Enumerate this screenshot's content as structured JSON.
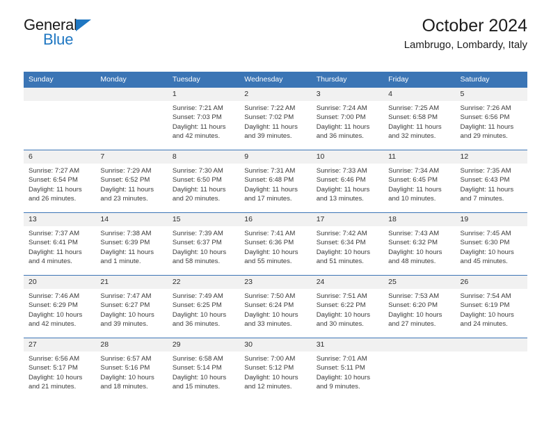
{
  "brand": {
    "name_top": "General",
    "name_bottom": "Blue",
    "accent_color": "#1f77c2"
  },
  "header": {
    "title": "October 2024",
    "subtitle": "Lambrugo, Lombardy, Italy"
  },
  "theme": {
    "header_blue": "#3b75b5",
    "daynum_band": "#f1f1f1",
    "text": "#3a3a3a"
  },
  "weekdays": [
    "Sunday",
    "Monday",
    "Tuesday",
    "Wednesday",
    "Thursday",
    "Friday",
    "Saturday"
  ],
  "weeks": [
    [
      {
        "day": "",
        "sunrise": "",
        "sunset": "",
        "daylight_line1": "",
        "daylight_line2": ""
      },
      {
        "day": "",
        "sunrise": "",
        "sunset": "",
        "daylight_line1": "",
        "daylight_line2": ""
      },
      {
        "day": "1",
        "sunrise": "Sunrise: 7:21 AM",
        "sunset": "Sunset: 7:03 PM",
        "daylight_line1": "Daylight: 11 hours",
        "daylight_line2": "and 42 minutes."
      },
      {
        "day": "2",
        "sunrise": "Sunrise: 7:22 AM",
        "sunset": "Sunset: 7:02 PM",
        "daylight_line1": "Daylight: 11 hours",
        "daylight_line2": "and 39 minutes."
      },
      {
        "day": "3",
        "sunrise": "Sunrise: 7:24 AM",
        "sunset": "Sunset: 7:00 PM",
        "daylight_line1": "Daylight: 11 hours",
        "daylight_line2": "and 36 minutes."
      },
      {
        "day": "4",
        "sunrise": "Sunrise: 7:25 AM",
        "sunset": "Sunset: 6:58 PM",
        "daylight_line1": "Daylight: 11 hours",
        "daylight_line2": "and 32 minutes."
      },
      {
        "day": "5",
        "sunrise": "Sunrise: 7:26 AM",
        "sunset": "Sunset: 6:56 PM",
        "daylight_line1": "Daylight: 11 hours",
        "daylight_line2": "and 29 minutes."
      }
    ],
    [
      {
        "day": "6",
        "sunrise": "Sunrise: 7:27 AM",
        "sunset": "Sunset: 6:54 PM",
        "daylight_line1": "Daylight: 11 hours",
        "daylight_line2": "and 26 minutes."
      },
      {
        "day": "7",
        "sunrise": "Sunrise: 7:29 AM",
        "sunset": "Sunset: 6:52 PM",
        "daylight_line1": "Daylight: 11 hours",
        "daylight_line2": "and 23 minutes."
      },
      {
        "day": "8",
        "sunrise": "Sunrise: 7:30 AM",
        "sunset": "Sunset: 6:50 PM",
        "daylight_line1": "Daylight: 11 hours",
        "daylight_line2": "and 20 minutes."
      },
      {
        "day": "9",
        "sunrise": "Sunrise: 7:31 AM",
        "sunset": "Sunset: 6:48 PM",
        "daylight_line1": "Daylight: 11 hours",
        "daylight_line2": "and 17 minutes."
      },
      {
        "day": "10",
        "sunrise": "Sunrise: 7:33 AM",
        "sunset": "Sunset: 6:46 PM",
        "daylight_line1": "Daylight: 11 hours",
        "daylight_line2": "and 13 minutes."
      },
      {
        "day": "11",
        "sunrise": "Sunrise: 7:34 AM",
        "sunset": "Sunset: 6:45 PM",
        "daylight_line1": "Daylight: 11 hours",
        "daylight_line2": "and 10 minutes."
      },
      {
        "day": "12",
        "sunrise": "Sunrise: 7:35 AM",
        "sunset": "Sunset: 6:43 PM",
        "daylight_line1": "Daylight: 11 hours",
        "daylight_line2": "and 7 minutes."
      }
    ],
    [
      {
        "day": "13",
        "sunrise": "Sunrise: 7:37 AM",
        "sunset": "Sunset: 6:41 PM",
        "daylight_line1": "Daylight: 11 hours",
        "daylight_line2": "and 4 minutes."
      },
      {
        "day": "14",
        "sunrise": "Sunrise: 7:38 AM",
        "sunset": "Sunset: 6:39 PM",
        "daylight_line1": "Daylight: 11 hours",
        "daylight_line2": "and 1 minute."
      },
      {
        "day": "15",
        "sunrise": "Sunrise: 7:39 AM",
        "sunset": "Sunset: 6:37 PM",
        "daylight_line1": "Daylight: 10 hours",
        "daylight_line2": "and 58 minutes."
      },
      {
        "day": "16",
        "sunrise": "Sunrise: 7:41 AM",
        "sunset": "Sunset: 6:36 PM",
        "daylight_line1": "Daylight: 10 hours",
        "daylight_line2": "and 55 minutes."
      },
      {
        "day": "17",
        "sunrise": "Sunrise: 7:42 AM",
        "sunset": "Sunset: 6:34 PM",
        "daylight_line1": "Daylight: 10 hours",
        "daylight_line2": "and 51 minutes."
      },
      {
        "day": "18",
        "sunrise": "Sunrise: 7:43 AM",
        "sunset": "Sunset: 6:32 PM",
        "daylight_line1": "Daylight: 10 hours",
        "daylight_line2": "and 48 minutes."
      },
      {
        "day": "19",
        "sunrise": "Sunrise: 7:45 AM",
        "sunset": "Sunset: 6:30 PM",
        "daylight_line1": "Daylight: 10 hours",
        "daylight_line2": "and 45 minutes."
      }
    ],
    [
      {
        "day": "20",
        "sunrise": "Sunrise: 7:46 AM",
        "sunset": "Sunset: 6:29 PM",
        "daylight_line1": "Daylight: 10 hours",
        "daylight_line2": "and 42 minutes."
      },
      {
        "day": "21",
        "sunrise": "Sunrise: 7:47 AM",
        "sunset": "Sunset: 6:27 PM",
        "daylight_line1": "Daylight: 10 hours",
        "daylight_line2": "and 39 minutes."
      },
      {
        "day": "22",
        "sunrise": "Sunrise: 7:49 AM",
        "sunset": "Sunset: 6:25 PM",
        "daylight_line1": "Daylight: 10 hours",
        "daylight_line2": "and 36 minutes."
      },
      {
        "day": "23",
        "sunrise": "Sunrise: 7:50 AM",
        "sunset": "Sunset: 6:24 PM",
        "daylight_line1": "Daylight: 10 hours",
        "daylight_line2": "and 33 minutes."
      },
      {
        "day": "24",
        "sunrise": "Sunrise: 7:51 AM",
        "sunset": "Sunset: 6:22 PM",
        "daylight_line1": "Daylight: 10 hours",
        "daylight_line2": "and 30 minutes."
      },
      {
        "day": "25",
        "sunrise": "Sunrise: 7:53 AM",
        "sunset": "Sunset: 6:20 PM",
        "daylight_line1": "Daylight: 10 hours",
        "daylight_line2": "and 27 minutes."
      },
      {
        "day": "26",
        "sunrise": "Sunrise: 7:54 AM",
        "sunset": "Sunset: 6:19 PM",
        "daylight_line1": "Daylight: 10 hours",
        "daylight_line2": "and 24 minutes."
      }
    ],
    [
      {
        "day": "27",
        "sunrise": "Sunrise: 6:56 AM",
        "sunset": "Sunset: 5:17 PM",
        "daylight_line1": "Daylight: 10 hours",
        "daylight_line2": "and 21 minutes."
      },
      {
        "day": "28",
        "sunrise": "Sunrise: 6:57 AM",
        "sunset": "Sunset: 5:16 PM",
        "daylight_line1": "Daylight: 10 hours",
        "daylight_line2": "and 18 minutes."
      },
      {
        "day": "29",
        "sunrise": "Sunrise: 6:58 AM",
        "sunset": "Sunset: 5:14 PM",
        "daylight_line1": "Daylight: 10 hours",
        "daylight_line2": "and 15 minutes."
      },
      {
        "day": "30",
        "sunrise": "Sunrise: 7:00 AM",
        "sunset": "Sunset: 5:12 PM",
        "daylight_line1": "Daylight: 10 hours",
        "daylight_line2": "and 12 minutes."
      },
      {
        "day": "31",
        "sunrise": "Sunrise: 7:01 AM",
        "sunset": "Sunset: 5:11 PM",
        "daylight_line1": "Daylight: 10 hours",
        "daylight_line2": "and 9 minutes."
      },
      {
        "day": "",
        "sunrise": "",
        "sunset": "",
        "daylight_line1": "",
        "daylight_line2": ""
      },
      {
        "day": "",
        "sunrise": "",
        "sunset": "",
        "daylight_line1": "",
        "daylight_line2": ""
      }
    ]
  ]
}
